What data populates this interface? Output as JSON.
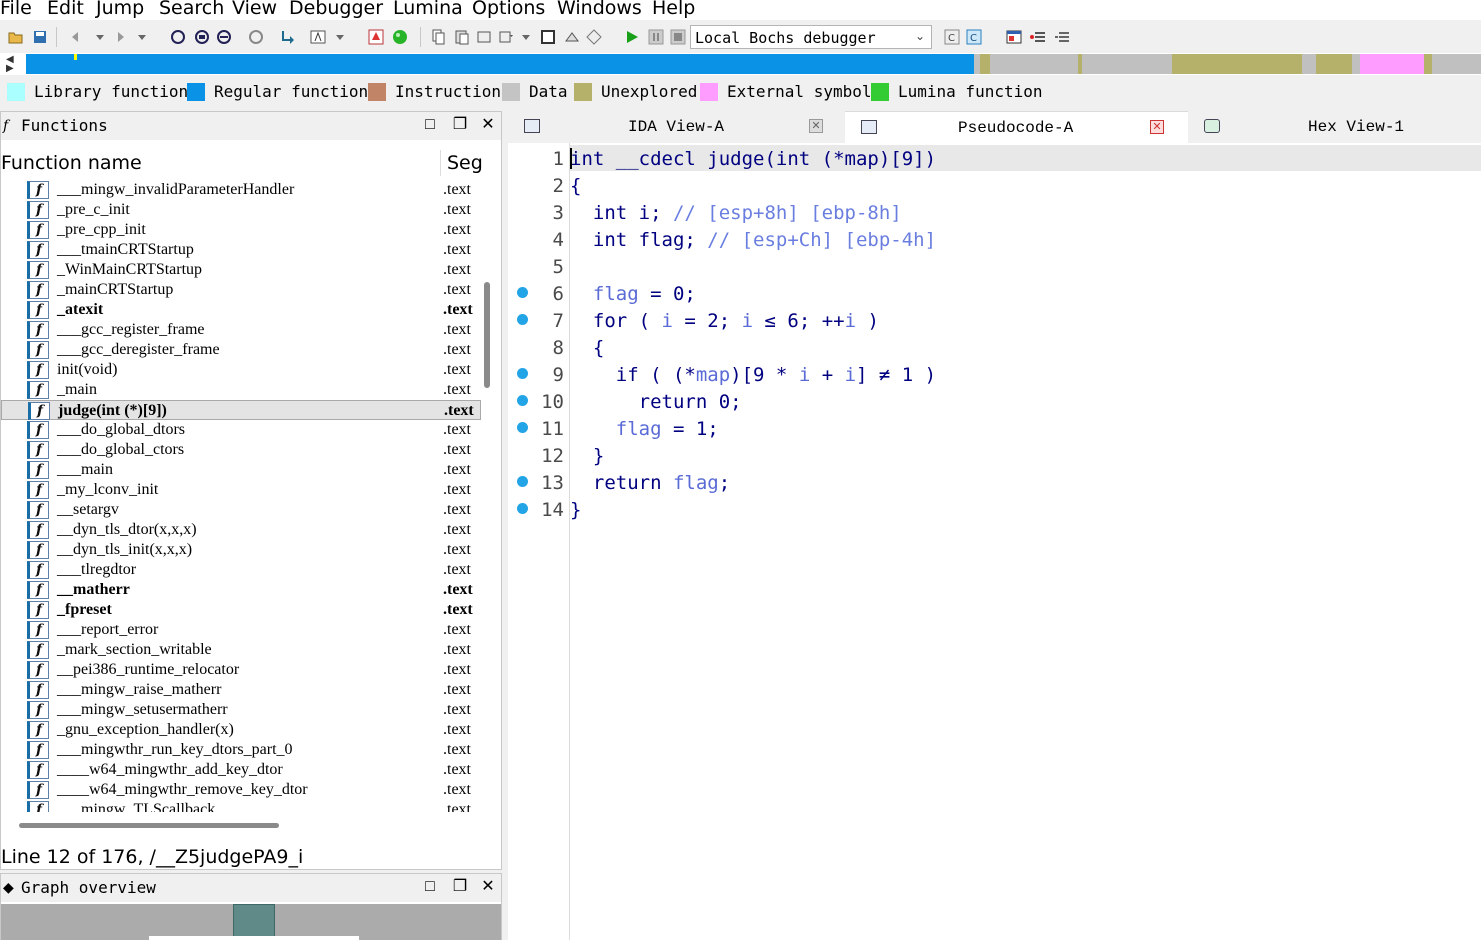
{
  "menu": [
    "File",
    "Edit",
    "Jump",
    "Search",
    "View",
    "Debugger",
    "Lumina",
    "Options",
    "Windows",
    "Help"
  ],
  "toolbar": {
    "debugger_select": "Local Bochs debugger"
  },
  "nav_colors": {
    "regular": "#0a93e6",
    "unexplored": "#b5b06a",
    "data": "#c0c0c0",
    "external": "#ff9cff",
    "library": "#aaffff"
  },
  "legend": [
    {
      "label": "Library function",
      "color": "#aaffff"
    },
    {
      "label": "Regular function",
      "color": "#0a93e6"
    },
    {
      "label": "Instruction",
      "color": "#c28467"
    },
    {
      "label": "Data",
      "color": "#c4c4c4"
    },
    {
      "label": "Unexplored",
      "color": "#b5b06a"
    },
    {
      "label": "External symbol",
      "color": "#ff9cff"
    },
    {
      "label": "Lumina function",
      "color": "#33cc33"
    }
  ],
  "functions_panel": {
    "title": "Functions",
    "col_name": "Function name",
    "col_seg": "Seg",
    "status": "Line 12 of 176, /__Z5judgePA9_i",
    "rows": [
      {
        "name": "___mingw_invalidParameterHandler",
        "seg": ".text",
        "bold": false
      },
      {
        "name": "_pre_c_init",
        "seg": ".text",
        "bold": false
      },
      {
        "name": "_pre_cpp_init",
        "seg": ".text",
        "bold": false
      },
      {
        "name": "___tmainCRTStartup",
        "seg": ".text",
        "bold": false
      },
      {
        "name": "_WinMainCRTStartup",
        "seg": ".text",
        "bold": false
      },
      {
        "name": "_mainCRTStartup",
        "seg": ".text",
        "bold": false
      },
      {
        "name": "_atexit",
        "seg": ".text",
        "bold": true
      },
      {
        "name": "___gcc_register_frame",
        "seg": ".text",
        "bold": false
      },
      {
        "name": "___gcc_deregister_frame",
        "seg": ".text",
        "bold": false
      },
      {
        "name": "init(void)",
        "seg": ".text",
        "bold": false
      },
      {
        "name": "_main",
        "seg": ".text",
        "bold": false
      },
      {
        "name": "judge(int (*)[9])",
        "seg": ".text",
        "bold": true,
        "selected": true
      },
      {
        "name": "___do_global_dtors",
        "seg": ".text",
        "bold": false
      },
      {
        "name": "___do_global_ctors",
        "seg": ".text",
        "bold": false
      },
      {
        "name": "___main",
        "seg": ".text",
        "bold": false
      },
      {
        "name": "_my_lconv_init",
        "seg": ".text",
        "bold": false
      },
      {
        "name": "__setargv",
        "seg": ".text",
        "bold": false
      },
      {
        "name": "__dyn_tls_dtor(x,x,x)",
        "seg": ".text",
        "bold": false
      },
      {
        "name": "__dyn_tls_init(x,x,x)",
        "seg": ".text",
        "bold": false
      },
      {
        "name": "___tlregdtor",
        "seg": ".text",
        "bold": false
      },
      {
        "name": "__matherr",
        "seg": ".text",
        "bold": true
      },
      {
        "name": "_fpreset",
        "seg": ".text",
        "bold": true
      },
      {
        "name": "___report_error",
        "seg": ".text",
        "bold": false
      },
      {
        "name": "_mark_section_writable",
        "seg": ".text",
        "bold": false
      },
      {
        "name": "__pei386_runtime_relocator",
        "seg": ".text",
        "bold": false
      },
      {
        "name": "___mingw_raise_matherr",
        "seg": ".text",
        "bold": false
      },
      {
        "name": "___mingw_setusermatherr",
        "seg": ".text",
        "bold": false
      },
      {
        "name": "_gnu_exception_handler(x)",
        "seg": ".text",
        "bold": false
      },
      {
        "name": "___mingwthr_run_key_dtors_part_0",
        "seg": ".text",
        "bold": false
      },
      {
        "name": "____w64_mingwthr_add_key_dtor",
        "seg": ".text",
        "bold": false
      },
      {
        "name": "____w64_mingwthr_remove_key_dtor",
        "seg": ".text",
        "bold": false
      },
      {
        "name": "___mingw_TLScallback",
        "seg": ".text",
        "bold": false
      }
    ]
  },
  "graph_panel": {
    "title": "Graph overview"
  },
  "tabs": [
    {
      "label": "IDA View-A",
      "active": false
    },
    {
      "label": "Pseudocode-A",
      "active": true
    },
    {
      "label": "Hex View-1",
      "active": false
    }
  ],
  "code": [
    {
      "n": "1",
      "dot": false,
      "parts": [
        [
          "k",
          "int __cdecl judge(int (*map)[9])"
        ]
      ]
    },
    {
      "n": "2",
      "dot": false,
      "parts": [
        [
          "k",
          "{"
        ]
      ]
    },
    {
      "n": "3",
      "dot": false,
      "parts": [
        [
          "k",
          "  int i; "
        ],
        [
          "c",
          "// [esp+8h] [ebp-8h]"
        ]
      ]
    },
    {
      "n": "4",
      "dot": false,
      "parts": [
        [
          "k",
          "  int flag; "
        ],
        [
          "c",
          "// [esp+Ch] [ebp-4h]"
        ]
      ]
    },
    {
      "n": "5",
      "dot": false,
      "parts": []
    },
    {
      "n": "6",
      "dot": true,
      "parts": [
        [
          "k",
          "  "
        ],
        [
          "v",
          "flag"
        ],
        [
          "k",
          " = 0;"
        ]
      ]
    },
    {
      "n": "7",
      "dot": true,
      "parts": [
        [
          "k",
          "  for ( "
        ],
        [
          "v",
          "i"
        ],
        [
          "k",
          " = 2; "
        ],
        [
          "v",
          "i"
        ],
        [
          "k",
          " ≤ 6; ++"
        ],
        [
          "v",
          "i"
        ],
        [
          "k",
          " )"
        ]
      ]
    },
    {
      "n": "8",
      "dot": false,
      "parts": [
        [
          "k",
          "  {"
        ]
      ]
    },
    {
      "n": "9",
      "dot": true,
      "parts": [
        [
          "k",
          "    if ( (*"
        ],
        [
          "v",
          "map"
        ],
        [
          "k",
          ")[9 * "
        ],
        [
          "v",
          "i"
        ],
        [
          "k",
          " + "
        ],
        [
          "v",
          "i"
        ],
        [
          "k",
          "] ≠ 1 )"
        ]
      ]
    },
    {
      "n": "10",
      "dot": true,
      "parts": [
        [
          "k",
          "      return 0;"
        ]
      ]
    },
    {
      "n": "11",
      "dot": true,
      "parts": [
        [
          "k",
          "    "
        ],
        [
          "v",
          "flag"
        ],
        [
          "k",
          " = 1;"
        ]
      ]
    },
    {
      "n": "12",
      "dot": false,
      "parts": [
        [
          "k",
          "  }"
        ]
      ]
    },
    {
      "n": "13",
      "dot": true,
      "parts": [
        [
          "k",
          "  return "
        ],
        [
          "v",
          "flag"
        ],
        [
          "k",
          ";"
        ]
      ]
    },
    {
      "n": "14",
      "dot": true,
      "parts": [
        [
          "k",
          "}"
        ]
      ]
    }
  ]
}
